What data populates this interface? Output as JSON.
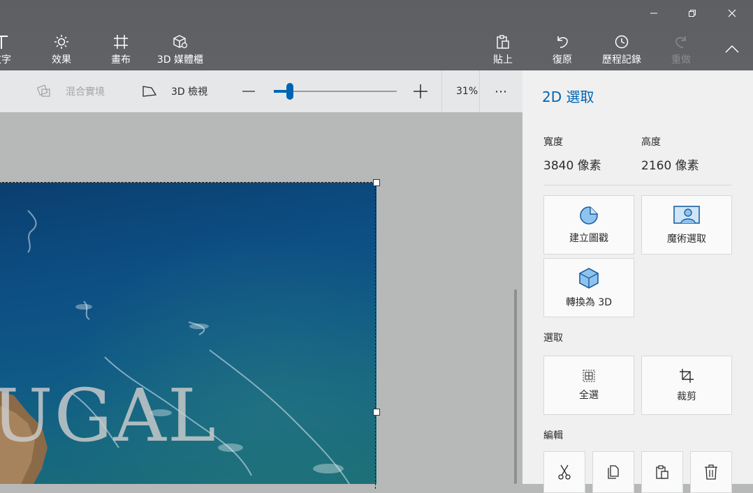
{
  "window_controls": {
    "minimize": "—",
    "restore": "❐",
    "close": "✕"
  },
  "toolbar": {
    "tools": [
      {
        "id": "text",
        "label": "文字",
        "icon": "text-icon"
      },
      {
        "id": "effects",
        "label": "效果",
        "icon": "effects-icon"
      },
      {
        "id": "canvas",
        "label": "畫布",
        "icon": "canvas-icon"
      },
      {
        "id": "library",
        "label": "3D 媒體櫃",
        "icon": "3d-library-icon"
      }
    ],
    "right_tools": [
      {
        "id": "paste",
        "label": "貼上",
        "icon": "paste-icon",
        "disabled": false
      },
      {
        "id": "undo",
        "label": "復原",
        "icon": "undo-icon",
        "disabled": false
      },
      {
        "id": "history",
        "label": "歷程記錄",
        "icon": "history-icon",
        "disabled": false
      },
      {
        "id": "redo",
        "label": "重做",
        "icon": "redo-icon",
        "disabled": true
      }
    ]
  },
  "commandbar": {
    "mixed_reality_label": "混合實境",
    "view3d_label": "3D 檢視",
    "zoom_value": 0.31,
    "zoom_text": "31%",
    "more_label": "⋯"
  },
  "canvas": {
    "overlay_text": "UGAL"
  },
  "panel": {
    "title": "2D 選取",
    "width_label": "寬度",
    "width_value": "3840 像素",
    "height_label": "高度",
    "height_value": "2160 像素",
    "actions": [
      {
        "id": "sticker",
        "label": "建立圖戳",
        "icon": "sticker-icon"
      },
      {
        "id": "magic",
        "label": "魔術選取",
        "icon": "magic-select-icon"
      },
      {
        "id": "to3d",
        "label": "轉換為 3D",
        "icon": "cube-icon"
      }
    ],
    "select_section": "選取",
    "select_actions": [
      {
        "id": "select_all",
        "label": "全選",
        "icon": "select-all-icon"
      },
      {
        "id": "crop",
        "label": "裁剪",
        "icon": "crop-icon"
      }
    ],
    "edit_section": "編輯",
    "edit_actions": [
      {
        "id": "cut",
        "icon": "cut-icon"
      },
      {
        "id": "copy",
        "icon": "copy-icon"
      },
      {
        "id": "paste",
        "icon": "paste-icon"
      },
      {
        "id": "delete",
        "icon": "delete-icon"
      }
    ],
    "accent_color": "#0063b1"
  }
}
